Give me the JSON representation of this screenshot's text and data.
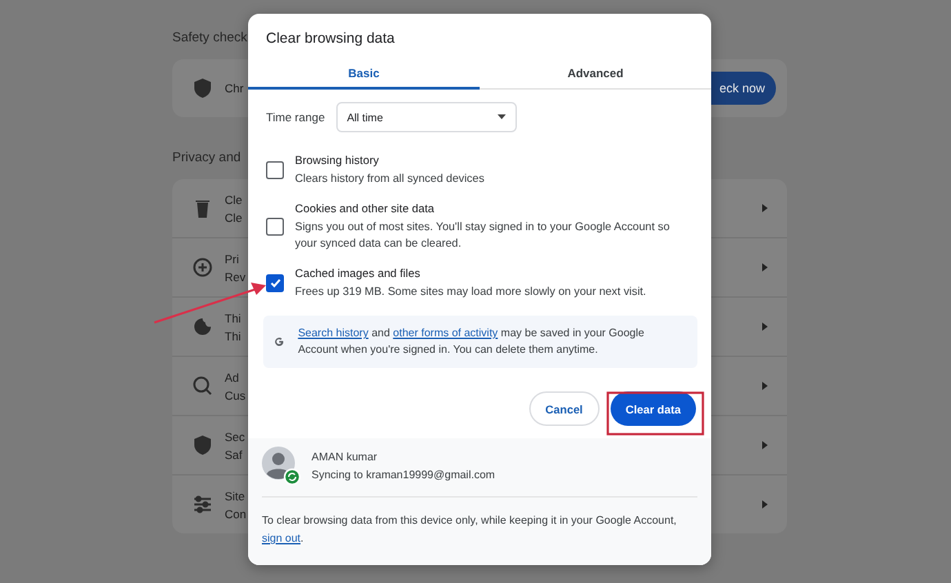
{
  "background": {
    "sections": [
      {
        "title": "Safety check",
        "rows": [
          {
            "title": "Chr",
            "button": "eck now"
          }
        ]
      },
      {
        "title": "Privacy and",
        "rows": [
          {
            "title": "Cle",
            "subtitle": "Cle"
          },
          {
            "title": "Pri",
            "subtitle": "Rev"
          },
          {
            "title": "Thi",
            "subtitle": "Thi"
          },
          {
            "title": "Ad",
            "subtitle": "Cus"
          },
          {
            "title": "Sec",
            "subtitle": "Saf"
          },
          {
            "title": "Site",
            "subtitle": "Con"
          }
        ]
      }
    ]
  },
  "dialog": {
    "title": "Clear browsing data",
    "tabs": [
      {
        "label": "Basic",
        "selected": true
      },
      {
        "label": "Advanced",
        "selected": false
      }
    ],
    "time_range": {
      "label": "Time range",
      "value": "All time"
    },
    "options": [
      {
        "label": "Browsing history",
        "description": "Clears history from all synced devices",
        "checked": false
      },
      {
        "label": "Cookies and other site data",
        "description": "Signs you out of most sites. You'll stay signed in to your Google Account so your synced data can be cleared.",
        "checked": false
      },
      {
        "label": "Cached images and files",
        "description": "Frees up 319 MB. Some sites may load more slowly on your next visit.",
        "checked": true
      }
    ],
    "notice": {
      "link_1": "Search history",
      "text_1": "and",
      "link_2": "other forms of activity",
      "text_2": "may be saved in your Google Account when you're signed in. You can delete them anytime."
    },
    "buttons": {
      "cancel": "Cancel",
      "confirm": "Clear data"
    },
    "account": {
      "name": "AMAN kumar",
      "status": "Syncing to kraman19999@gmail.com"
    },
    "footer": {
      "text": "To clear browsing data from this device only, while keeping it in your Google Account,",
      "link": "sign out",
      "end": "."
    }
  }
}
